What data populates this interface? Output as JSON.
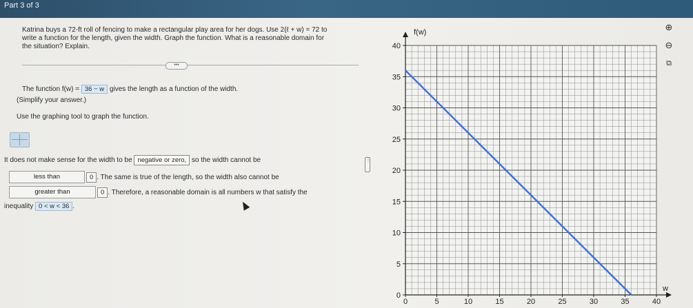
{
  "header": {
    "part": "Part 3 of 3"
  },
  "problem": {
    "line1": "Katrina buys a 72-ft roll of fencing to make a rectangular play area for her dogs. Use 2(ℓ + w) = 72 to",
    "line2": "write a function for the length, given the width. Graph the function. What is a reasonable domain for",
    "line3": "the situation? Explain."
  },
  "divider_dots": "•••",
  "function_line": {
    "prefix": "The function f(w) =",
    "answer": "36 − w",
    "suffix": "gives the length as a function of the width."
  },
  "simplify_note": "(Simplify your answer.)",
  "graph_instruction": "Use the graphing tool to graph the function.",
  "sentence1": {
    "prefix": "It does not make sense for the width to be",
    "answer": "negative or zero,",
    "suffix": "so the width cannot be"
  },
  "choice_less": "less than",
  "sentence2": {
    "value": "0",
    "suffix": ". The same is true of the length, so the width also cannot be"
  },
  "choice_greater": "greater than",
  "sentence3": {
    "value": "0",
    "suffix": ". Therefore, a reasonable domain is all numbers w that satisfy the"
  },
  "inequality": {
    "label": "inequality",
    "answer": "0 < w < 36",
    "end": "."
  },
  "handle_glyph": "⋮",
  "side_buttons": {
    "zoom_in": "⊕",
    "zoom_out": "⊖",
    "popout": "⧉"
  },
  "chart_data": {
    "type": "line",
    "series": [
      {
        "x": [
          0,
          36
        ],
        "y": [
          36,
          0
        ],
        "color": "#3b6fd6"
      }
    ],
    "xlabel": "w",
    "ylabel": "f(w)",
    "xlim": [
      0,
      40
    ],
    "ylim": [
      0,
      40
    ],
    "x_ticks": [
      0,
      5,
      10,
      15,
      20,
      25,
      30,
      35,
      40
    ],
    "y_ticks": [
      0,
      5,
      10,
      15,
      20,
      25,
      30,
      35,
      40
    ],
    "grid": true
  }
}
